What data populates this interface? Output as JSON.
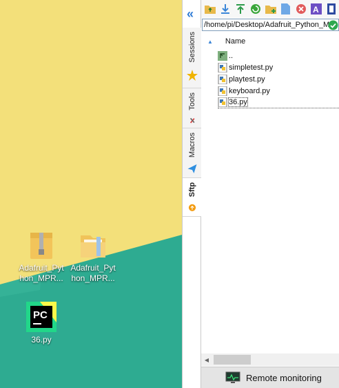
{
  "desktop": {
    "colors": {
      "yellow": "#f3e07a",
      "teal": "#2eab91"
    },
    "icons": [
      {
        "label": "Adafruit_Python_MPR...",
        "icon": "zip-folder-icon"
      },
      {
        "label": "Adafruit_Python_MPR...",
        "icon": "folder-icon"
      },
      {
        "label": "36.py",
        "icon": "pycharm-icon"
      }
    ]
  },
  "sidebar": {
    "collapse_icon": "double-chevron-left-icon",
    "tabs": [
      {
        "label": "Sessions",
        "icon": "star-icon"
      },
      {
        "label": "Tools",
        "icon": "tools-icon"
      },
      {
        "label": "Macros",
        "icon": "paper-plane-icon"
      },
      {
        "label": "Sftp",
        "icon": "sftp-icon",
        "active": true
      }
    ]
  },
  "sftp": {
    "toolbar": [
      "parent-folder-icon",
      "download-icon",
      "upload-icon",
      "refresh-icon",
      "new-folder-icon",
      "new-file-icon",
      "delete-icon",
      "rename-icon",
      "more-icon"
    ],
    "path": "/home/pi/Desktop/Adafruit_Python_MP",
    "column_name": "Name",
    "files": [
      {
        "name": "..",
        "type": "parent"
      },
      {
        "name": "simpletest.py",
        "type": "python"
      },
      {
        "name": "playtest.py",
        "type": "python"
      },
      {
        "name": "keyboard.py",
        "type": "python"
      },
      {
        "name": "36.py",
        "type": "python",
        "selected": true
      }
    ],
    "remote_monitoring_label": "Remote monitoring"
  }
}
